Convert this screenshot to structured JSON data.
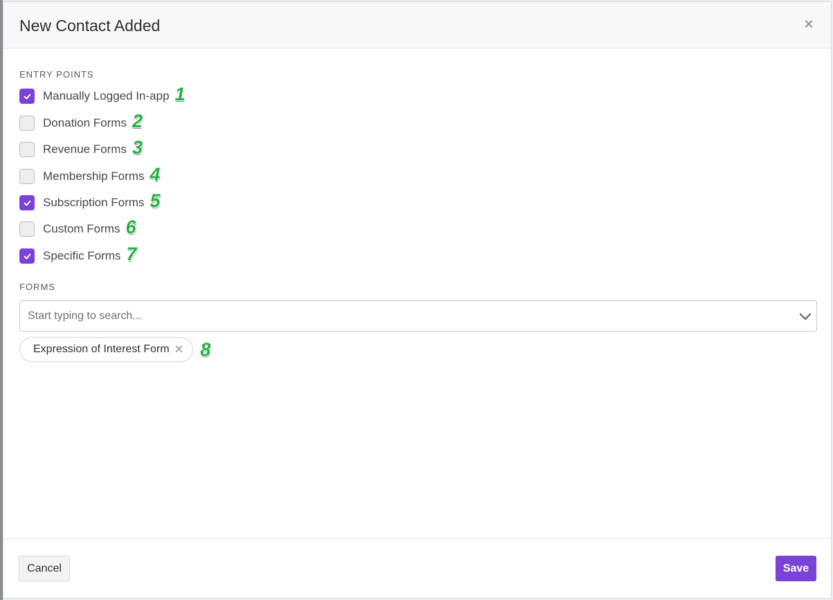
{
  "modal": {
    "title": "New Contact Added",
    "close_icon": "close-icon",
    "close_glyph": "×"
  },
  "entry_points": {
    "label": "ENTRY POINTS",
    "items": [
      {
        "label": "Manually Logged In-app",
        "checked": true,
        "badge": "1"
      },
      {
        "label": "Donation Forms",
        "checked": false,
        "badge": "2"
      },
      {
        "label": "Revenue Forms",
        "checked": false,
        "badge": "3"
      },
      {
        "label": "Membership Forms",
        "checked": false,
        "badge": "4"
      },
      {
        "label": "Subscription Forms",
        "checked": true,
        "badge": "5"
      },
      {
        "label": "Custom Forms",
        "checked": false,
        "badge": "6"
      },
      {
        "label": "Specific Forms",
        "checked": true,
        "badge": "7"
      }
    ]
  },
  "forms": {
    "label": "FORMS",
    "search": {
      "placeholder": "Start typing to search...",
      "value": ""
    },
    "dropdown_icon": "chevron-down-icon",
    "selected": [
      {
        "label": "Expression of Interest Form",
        "remove_glyph": "×",
        "badge": "8"
      }
    ]
  },
  "footer": {
    "cancel_label": "Cancel",
    "save_label": "Save"
  },
  "colors": {
    "accent": "#7b42d8",
    "badge": "#27b043"
  }
}
